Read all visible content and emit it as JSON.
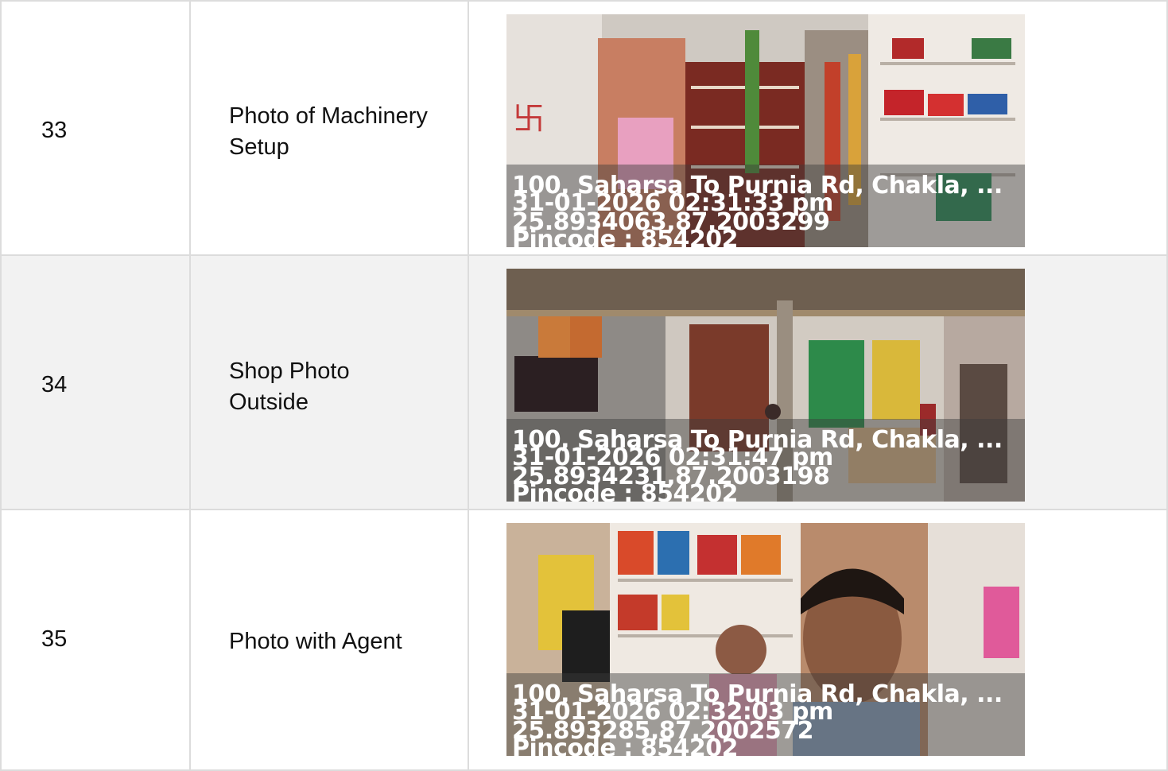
{
  "rows": [
    {
      "number": "33",
      "label": "Photo of Machinery Setup",
      "photo": {
        "subject": "shop interior shelves",
        "address": "100, Saharsa To Purnia Rd, Chakla, ...",
        "datetime": "31-01-2026 02:31:33 pm",
        "coords": "25.8934063,87.2003299",
        "pincode": "Pincode : 854202"
      }
    },
    {
      "number": "34",
      "label": "Shop Photo Outside",
      "photo": {
        "subject": "shop exterior",
        "address": "100, Saharsa To Purnia Rd, Chakla, ...",
        "datetime": "31-01-2026 02:31:47 pm",
        "coords": "25.8934231,87.2003198",
        "pincode": "Pincode : 854202"
      }
    },
    {
      "number": "35",
      "label": "Photo with Agent",
      "photo": {
        "subject": "selfie with shopkeeper",
        "address": "100, Saharsa To Purnia Rd, Chakla, ...",
        "datetime": "31-01-2026 02:32:03 pm",
        "coords": "25.893285,87.2002572",
        "pincode": "Pincode : 854202"
      }
    }
  ],
  "colors": {
    "border": "#dcdcdc",
    "row_alt_background": "#f2f2f2",
    "overlay_text": "#ffffff"
  }
}
